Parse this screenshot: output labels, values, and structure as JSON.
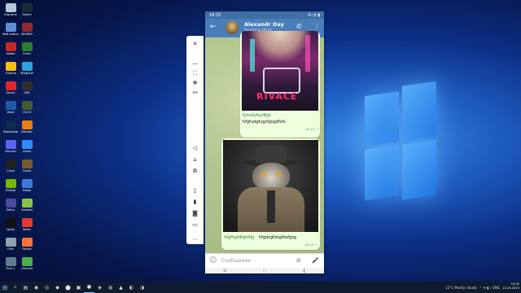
{
  "desktop": {
    "icons": [
      {
        "label": "Корзина",
        "color": "#b7c7d8"
      },
      {
        "label": "Steam",
        "color": "#1b2838"
      },
      {
        "label": "Мой компьютер",
        "color": "#5c8fd6"
      },
      {
        "label": "WinRAR",
        "color": "#8b2d2d"
      },
      {
        "label": "Adobe",
        "color": "#c62828"
      },
      {
        "label": "Excel",
        "color": "#2e7d32"
      },
      {
        "label": "Chrome",
        "color": "#f4c20d"
      },
      {
        "label": "Telegram",
        "color": "#2aa3e0"
      },
      {
        "label": "Opera",
        "color": "#e0242b"
      },
      {
        "label": "OBS",
        "color": "#302e31"
      },
      {
        "label": "Word",
        "color": "#1e5aa8"
      },
      {
        "label": "CS:GO",
        "color": "#445a32"
      },
      {
        "label": "Photoshop",
        "color": "#0d2a4d"
      },
      {
        "label": "Blender",
        "color": "#e87d0d"
      },
      {
        "label": "Discord",
        "color": "#5865f2"
      },
      {
        "label": "Zoom",
        "color": "#2d8cff"
      },
      {
        "label": "Clock",
        "color": "#222"
      },
      {
        "label": "Game",
        "color": "#7a5a2a"
      },
      {
        "label": "NVIDIA",
        "color": "#76b900"
      },
      {
        "label": "Media",
        "color": "#3d7ad6"
      },
      {
        "label": "Editor",
        "color": "#4b4b9a"
      },
      {
        "label": "Android",
        "color": "#8bc34a"
      },
      {
        "label": "Uplay",
        "color": "#111"
      },
      {
        "label": "Notes",
        "color": "#e53935"
      },
      {
        "label": "Files",
        "color": "#90a4ae"
      },
      {
        "label": "Firefox",
        "color": "#ff7139"
      },
      {
        "label": "Files 2",
        "color": "#607d8b"
      },
      {
        "label": "uTorrent",
        "color": "#4caf50"
      }
    ]
  },
  "taskbar": {
    "start_glyph": "⊞",
    "apps": [
      "⌕",
      "▤",
      "◉",
      "◎",
      "◆",
      "⬤",
      "▣",
      "●",
      "◈",
      "◍",
      "▲",
      "◐",
      "◑"
    ],
    "weather": "11°C Mostly cloudy",
    "tray_icons": "⌃ ◔ ▮ ♪ ENG",
    "time": "18:32",
    "date": "22.03.2023"
  },
  "sidebar": {
    "buttons": [
      {
        "name": "close-icon",
        "glyph": "✕"
      },
      {
        "name": "minimize-icon",
        "glyph": "—"
      },
      {
        "name": "fullscreen-icon",
        "glyph": "⛶"
      },
      {
        "name": "pin-icon",
        "glyph": "✥"
      },
      {
        "name": "link-icon",
        "glyph": "⚯"
      },
      {
        "name": "volume-icon",
        "glyph": "◁"
      },
      {
        "name": "home-icon",
        "glyph": "⌂"
      },
      {
        "name": "overview-icon",
        "glyph": "⧉"
      },
      {
        "name": "tablet-icon",
        "glyph": "▯"
      },
      {
        "name": "phone-icon",
        "glyph": "▮"
      },
      {
        "name": "camera-icon",
        "glyph": "◙"
      },
      {
        "name": "folder-icon",
        "glyph": "▭"
      },
      {
        "name": "more-icon",
        "glyph": "⋯"
      }
    ]
  },
  "phone": {
    "status_time": "18:32",
    "status_icons": "⁂ ◔ ▮",
    "chat": {
      "back_glyph": "←",
      "name": "Alexandr Day",
      "last_seen": "был(а) в 19:22",
      "call_glyph": "✆",
      "menu_glyph": "⋮"
    },
    "messages": [
      {
        "link": "fysudyfsydfgs",
        "text": "hfgfudgfugsfgsgdfsfs",
        "time": "18:13",
        "image_text": "RIVACE"
      },
      {
        "link": "hfgfhgfdfghfdg",
        "text": "hfgdsgfdsgfdsfgsg",
        "time": "18:17"
      }
    ],
    "input": {
      "emoji_glyph": "☺",
      "placeholder": "Сообщение",
      "attach_glyph": "⌀",
      "mic_glyph": "🎤"
    },
    "nav": [
      "☰",
      "▢",
      "❮"
    ]
  }
}
